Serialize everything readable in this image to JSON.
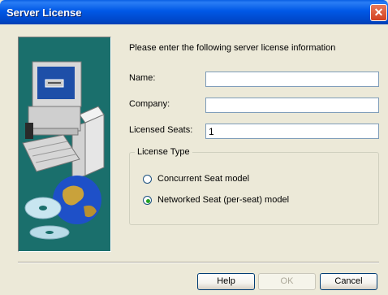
{
  "window": {
    "title": "Server License"
  },
  "header": {
    "prompt": "Please enter the following server license information"
  },
  "fields": {
    "name": {
      "label": "Name:",
      "value": ""
    },
    "company": {
      "label": "Company:",
      "value": ""
    },
    "seats": {
      "label": "Licensed Seats:",
      "value": "1"
    }
  },
  "license_type": {
    "group_label": "License Type",
    "options": [
      {
        "label": "Concurrent Seat model",
        "selected": false
      },
      {
        "label": "Networked Seat (per-seat) model",
        "selected": true
      }
    ]
  },
  "buttons": {
    "help": "Help",
    "ok": "OK",
    "cancel": "Cancel"
  },
  "colors": {
    "titlebar": "#0058e6",
    "panel_teal": "#1a6f6c",
    "selected_radio": "#21a121"
  }
}
